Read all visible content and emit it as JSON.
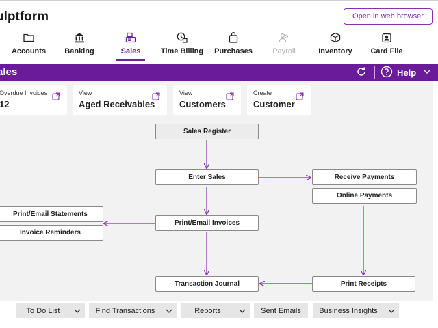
{
  "app": {
    "company_name": "ulptform",
    "open_web_label": "Open in web browser"
  },
  "nav": [
    {
      "label": "Accounts",
      "icon": "folder-icon",
      "state": "normal"
    },
    {
      "label": "Banking",
      "icon": "bank-icon",
      "state": "normal"
    },
    {
      "label": "Sales",
      "icon": "cash-register-icon",
      "state": "active"
    },
    {
      "label": "Time Billing",
      "icon": "clock-document-icon",
      "state": "normal"
    },
    {
      "label": "Purchases",
      "icon": "shopping-bag-icon",
      "state": "normal"
    },
    {
      "label": "Payroll",
      "icon": "people-icon",
      "state": "disabled"
    },
    {
      "label": "Inventory",
      "icon": "box-icon",
      "state": "normal"
    },
    {
      "label": "Card File",
      "icon": "contact-card-icon",
      "state": "normal"
    }
  ],
  "section": {
    "title": "ales",
    "help_label": "Help",
    "accent": "#6a1b9a"
  },
  "cards": [
    {
      "caption": "Overdue Invoices",
      "value": "12"
    },
    {
      "caption": "View",
      "value": "Aged Receivables"
    },
    {
      "caption": "View",
      "value": "Customers"
    },
    {
      "caption": "Create",
      "value": "Customer"
    }
  ],
  "flowchart": {
    "sales_register": "Sales Register",
    "enter_sales": "Enter Sales",
    "receive_payments": "Receive Payments",
    "online_payments": "Online Payments",
    "print_email_statements": "Print/Email Statements",
    "invoice_reminders": "Invoice Reminders",
    "print_email_invoices": "Print/Email Invoices",
    "transaction_journal": "Transaction Journal",
    "print_receipts": "Print Receipts",
    "arrow_color": "#8a2fb0"
  },
  "bottom": {
    "todo": "To Do List",
    "find": "Find Transactions",
    "reports": "Reports",
    "sent_emails": "Sent Emails",
    "insights": "Business Insights"
  }
}
